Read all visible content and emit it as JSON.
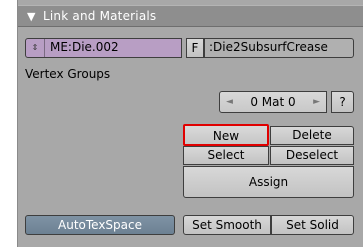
{
  "panel": {
    "title": "Link and Materials",
    "collapse_glyph": "▼"
  },
  "mesh": {
    "arrows_glyph": "⇕",
    "name": "ME:Die.002",
    "fake_user_label": "F",
    "object_name": ":Die2SubsurfCrease"
  },
  "vertex_groups": {
    "label": "Vertex Groups"
  },
  "material": {
    "prev_glyph": "◄",
    "next_glyph": "►",
    "value": "0 Mat 0",
    "help_label": "?"
  },
  "buttons": {
    "new": "New",
    "delete": "Delete",
    "select": "Select",
    "deselect": "Deselect",
    "assign": "Assign",
    "autotexspace": "AutoTexSpace",
    "set_smooth": "Set Smooth",
    "set_solid": "Set Solid"
  },
  "colors": {
    "panel_bg": "#a8a8a8",
    "header_bg": "#8e8e8e",
    "mesh_field": "#b89ec4",
    "autotex_active": "#75899b",
    "highlight_border": "#e00000"
  }
}
